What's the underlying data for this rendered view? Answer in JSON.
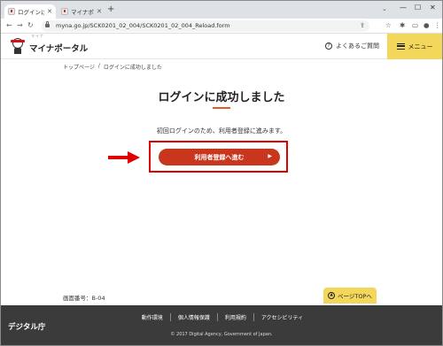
{
  "browser": {
    "tabs": [
      {
        "title": "ログインに成功しました",
        "active": true
      },
      {
        "title": "マイナポ…",
        "active": false
      }
    ],
    "new_tab": "+",
    "url": "myna.go.jp/SCK0201_02_004/SCK0201_02_004_Reload.form",
    "window_controls": [
      "—",
      "☐",
      "✕"
    ],
    "tab_search": "⌄"
  },
  "header": {
    "logo_ruby": "マイナ",
    "logo_text": "マイナポータル",
    "faq_label": "よくあるご質問",
    "menu_label": "メニュー",
    "accent_color": "#f3d75a"
  },
  "breadcrumb": {
    "items": [
      "トップページ",
      "/",
      "ログインに成功しました"
    ]
  },
  "main": {
    "title": "ログインに成功しました",
    "lead": "初回ログインのため、利用者登録に進みます。",
    "primary_button": "利用者登録へ進む",
    "primary_button_color": "#c8361e",
    "highlight_color": "#e00000"
  },
  "bottom": {
    "screen_number": "画面番号：B-04",
    "page_top": "ページTOPへ"
  },
  "footer": {
    "logo": "デジタル庁",
    "links": [
      "動作環境",
      "個人情報保護",
      "利用規約",
      "アクセシビリティ"
    ],
    "copyright": "© 2017 Digital Agency, Government of Japan."
  }
}
